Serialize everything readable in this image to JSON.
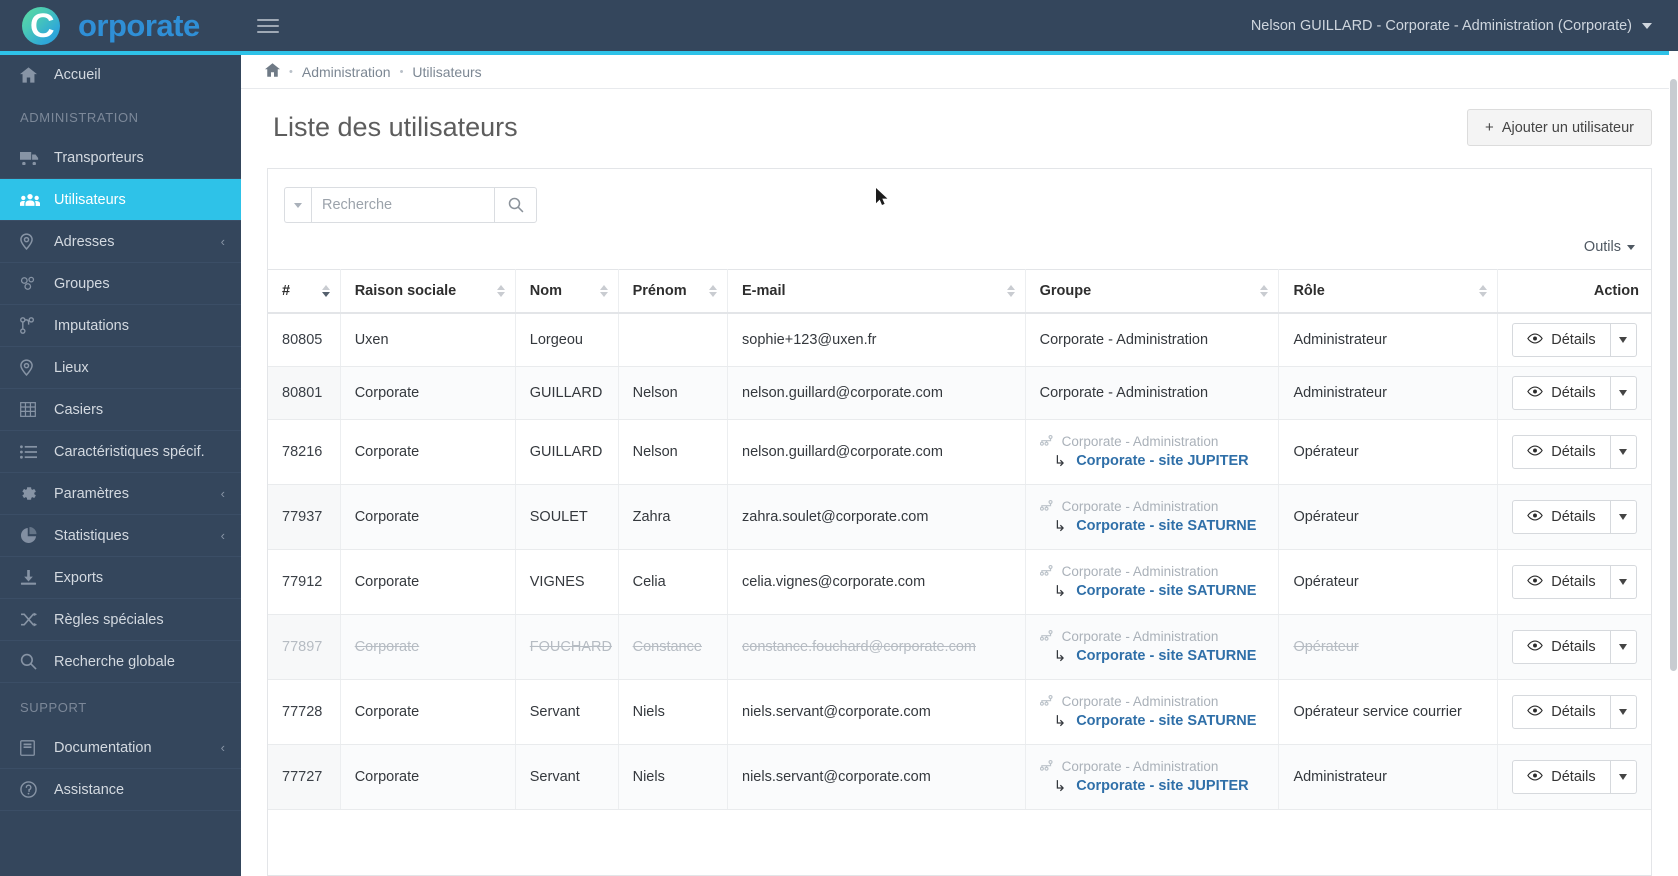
{
  "brand": {
    "logo_letter": "C",
    "name": "orporate",
    "menu_toggle_icon": "hamburger-icon"
  },
  "topbar": {
    "user_label": "Nelson GUILLARD - Corporate - Administration (Corporate)",
    "caret_icon": "chevron-down-icon"
  },
  "sidebar": {
    "home": {
      "label": "Accueil",
      "icon": "home-icon"
    },
    "section_admin": "ADMINISTRATION",
    "section_support": "SUPPORT",
    "items": [
      {
        "label": "Transporteurs",
        "icon": "truck-icon",
        "active": false,
        "expandable": false
      },
      {
        "label": "Utilisateurs",
        "icon": "users-icon",
        "active": true,
        "expandable": false
      },
      {
        "label": "Adresses",
        "icon": "map-pin-icon",
        "active": false,
        "expandable": true
      },
      {
        "label": "Groupes",
        "icon": "group-nodes-icon",
        "active": false,
        "expandable": false
      },
      {
        "label": "Imputations",
        "icon": "sitemap-icon",
        "active": false,
        "expandable": false
      },
      {
        "label": "Lieux",
        "icon": "map-pin-icon",
        "active": false,
        "expandable": false
      },
      {
        "label": "Casiers",
        "icon": "grid-icon",
        "active": false,
        "expandable": false
      },
      {
        "label": "Caractéristiques spécif.",
        "icon": "list-icon",
        "active": false,
        "expandable": false
      },
      {
        "label": "Paramètres",
        "icon": "gear-icon",
        "active": false,
        "expandable": true
      },
      {
        "label": "Statistiques",
        "icon": "pie-chart-icon",
        "active": false,
        "expandable": true
      },
      {
        "label": "Exports",
        "icon": "download-icon",
        "active": false,
        "expandable": false
      },
      {
        "label": "Règles spéciales",
        "icon": "shuffle-icon",
        "active": false,
        "expandable": false
      },
      {
        "label": "Recherche globale",
        "icon": "search-icon",
        "active": false,
        "expandable": false
      }
    ],
    "support_items": [
      {
        "label": "Documentation",
        "icon": "book-icon",
        "active": false,
        "expandable": true
      },
      {
        "label": "Assistance",
        "icon": "question-circle-icon",
        "active": false,
        "expandable": false
      }
    ]
  },
  "breadcrumb": {
    "home_icon": "home-icon",
    "items": [
      "Administration",
      "Utilisateurs"
    ],
    "separator": "•"
  },
  "page": {
    "title": "Liste des utilisateurs",
    "add_button": {
      "label": "Ajouter un utilisateur",
      "icon": "plus-icon"
    }
  },
  "search": {
    "placeholder": "Recherche",
    "value": "",
    "dropdown_icon": "caret-down-icon",
    "submit_icon": "search-icon"
  },
  "tools": {
    "label": "Outils",
    "caret_icon": "caret-down-icon"
  },
  "table": {
    "columns": [
      {
        "label": "#",
        "sorted": true,
        "sort_dir": "desc"
      },
      {
        "label": "Raison sociale",
        "sorted": false
      },
      {
        "label": "Nom",
        "sorted": false
      },
      {
        "label": "Prénom",
        "sorted": false
      },
      {
        "label": "E-mail",
        "sorted": false
      },
      {
        "label": "Groupe",
        "sorted": false
      },
      {
        "label": "Rôle",
        "sorted": false
      },
      {
        "label": "Action",
        "sorted": false
      }
    ],
    "action": {
      "details_label": "Détails",
      "details_icon": "eye-icon",
      "caret_icon": "caret-down-icon"
    },
    "rows": [
      {
        "id": "80805",
        "raison_sociale": "Uxen",
        "nom": "Lorgeou",
        "prenom": "",
        "email": "sophie+123@uxen.fr",
        "group_parent": "",
        "group_child": "",
        "group_plain": "Corporate - Administration",
        "role": "Administrateur",
        "disabled": false
      },
      {
        "id": "80801",
        "raison_sociale": "Corporate",
        "nom": "GUILLARD",
        "prenom": "Nelson",
        "email": "nelson.guillard@corporate.com",
        "group_parent": "",
        "group_child": "",
        "group_plain": "Corporate - Administration",
        "role": "Administrateur",
        "disabled": false
      },
      {
        "id": "78216",
        "raison_sociale": "Corporate",
        "nom": "GUILLARD",
        "prenom": "Nelson",
        "email": "nelson.guillard@corporate.com",
        "group_parent": "Corporate - Administration",
        "group_child": "Corporate - site JUPITER",
        "group_plain": "",
        "role": "Opérateur",
        "disabled": false
      },
      {
        "id": "77937",
        "raison_sociale": "Corporate",
        "nom": "SOULET",
        "prenom": "Zahra",
        "email": "zahra.soulet@corporate.com",
        "group_parent": "Corporate - Administration",
        "group_child": "Corporate - site SATURNE",
        "group_plain": "",
        "role": "Opérateur",
        "disabled": false
      },
      {
        "id": "77912",
        "raison_sociale": "Corporate",
        "nom": "VIGNES",
        "prenom": "Celia",
        "email": "celia.vignes@corporate.com",
        "group_parent": "Corporate - Administration",
        "group_child": "Corporate - site SATURNE",
        "group_plain": "",
        "role": "Opérateur",
        "disabled": false
      },
      {
        "id": "77897",
        "raison_sociale": "Corporate",
        "nom": "FOUCHARD",
        "prenom": "Constance",
        "email": "constance.fouchard@corporate.com",
        "group_parent": "Corporate - Administration",
        "group_child": "Corporate - site SATURNE",
        "group_plain": "",
        "role": "Opérateur",
        "disabled": true
      },
      {
        "id": "77728",
        "raison_sociale": "Corporate",
        "nom": "Servant",
        "prenom": "Niels",
        "email": "niels.servant@corporate.com",
        "group_parent": "Corporate - Administration",
        "group_child": "Corporate - site SATURNE",
        "group_plain": "",
        "role": "Opérateur service courrier",
        "disabled": false
      },
      {
        "id": "77727",
        "raison_sociale": "Corporate",
        "nom": "Servant",
        "prenom": "Niels",
        "email": "niels.servant@corporate.com",
        "group_parent": "Corporate - Administration",
        "group_child": "Corporate - site JUPITER",
        "group_plain": "",
        "role": "Administrateur",
        "disabled": false
      }
    ]
  },
  "colors": {
    "accent": "#2ec2e8",
    "sidebar_bg": "#34465c",
    "link_blue": "#2f6fa8",
    "brand_blue": "#2f8fd6"
  }
}
